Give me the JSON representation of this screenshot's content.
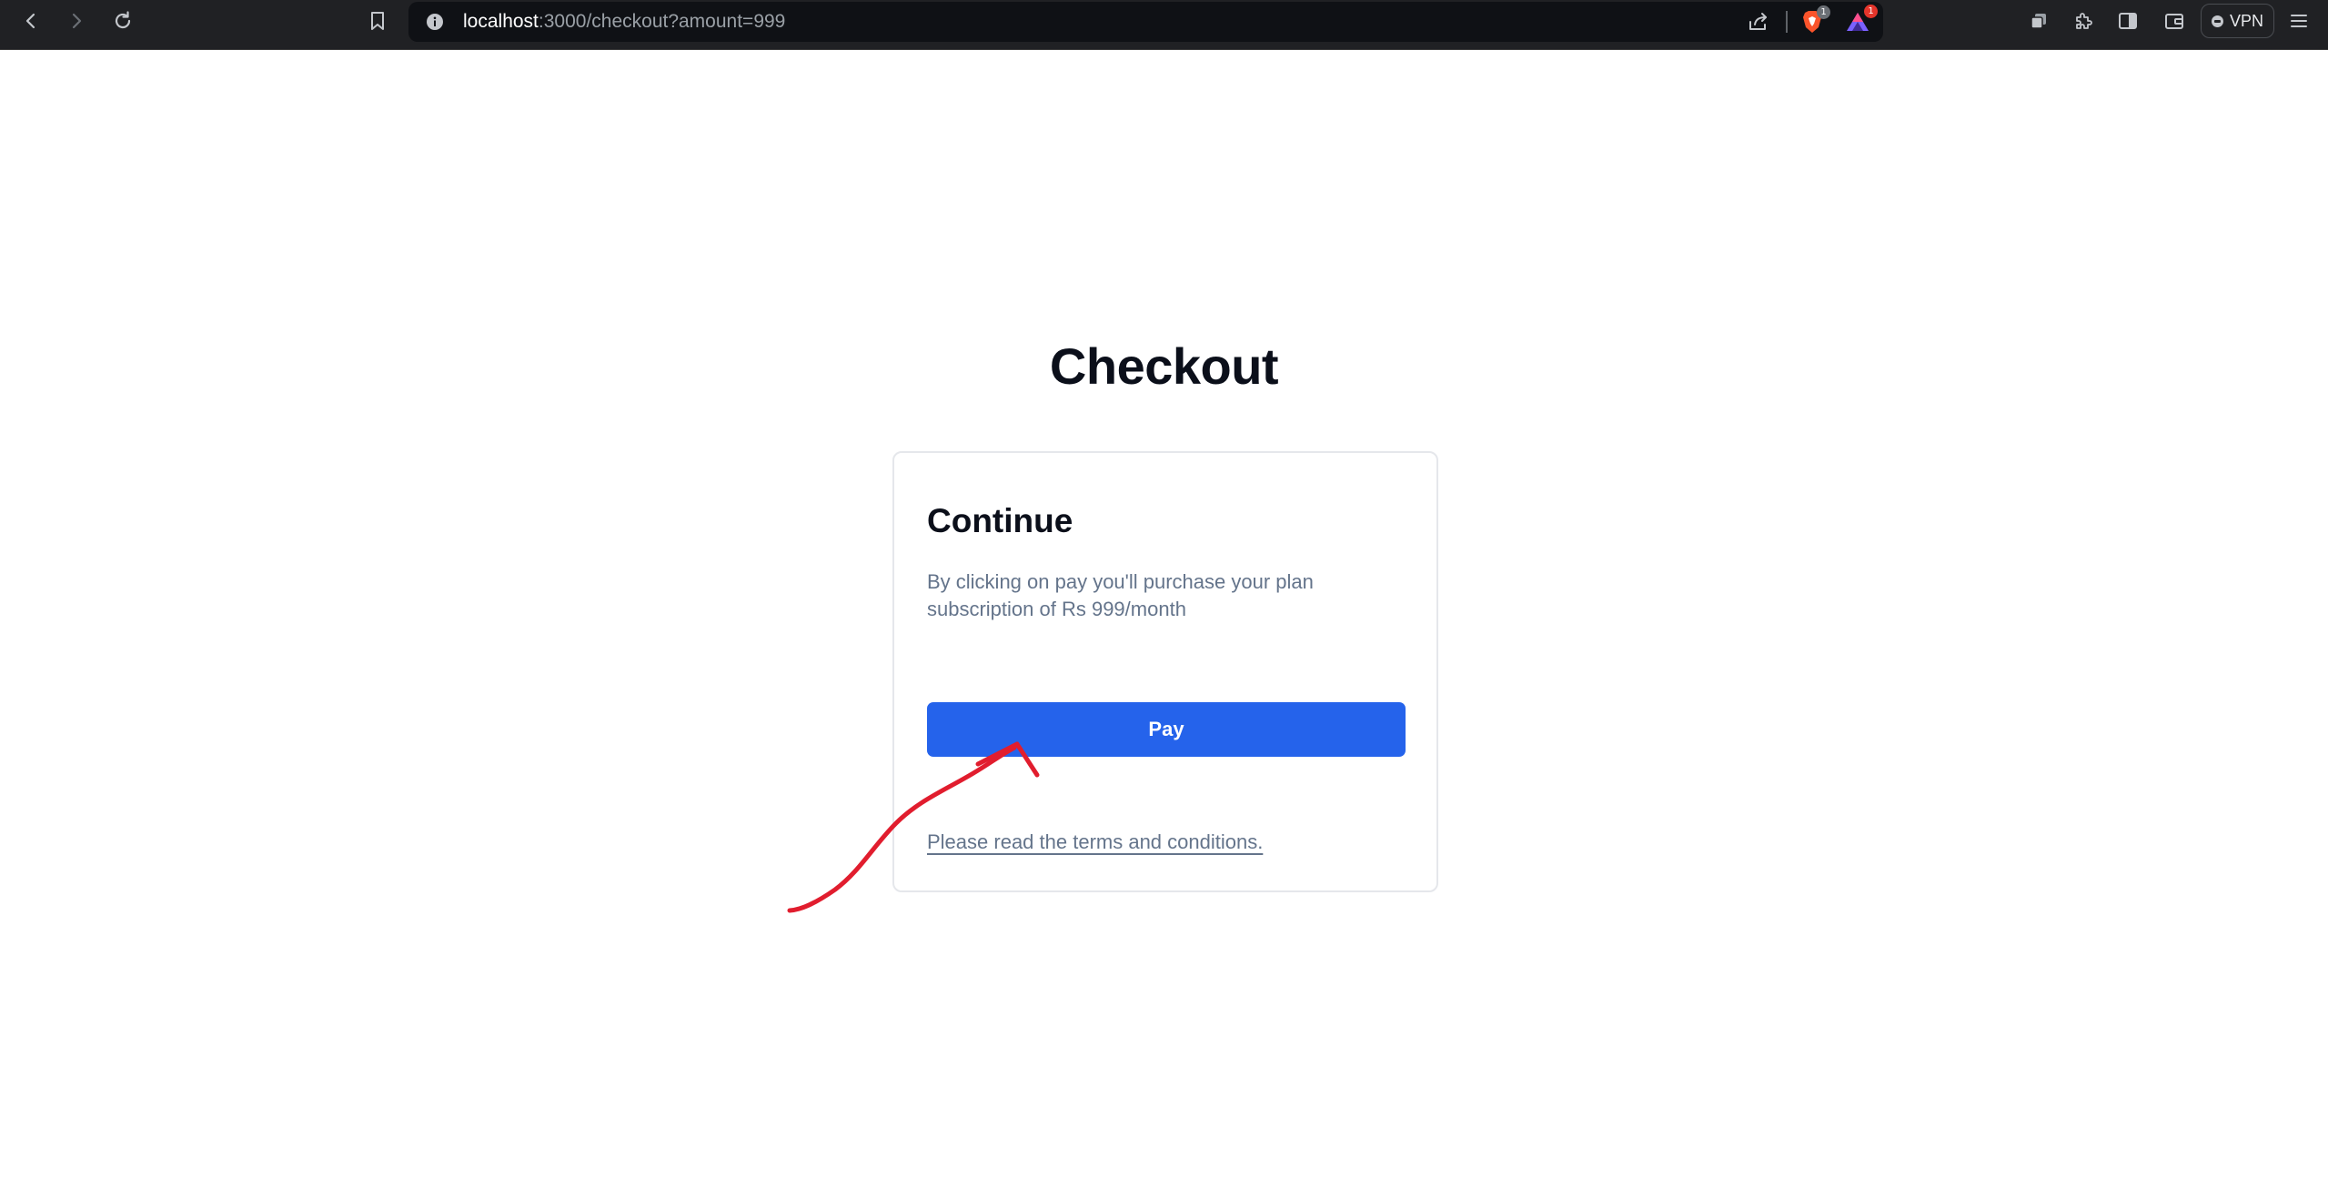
{
  "browser": {
    "url_host": "localhost",
    "url_path": ":3000/checkout?amount=999",
    "shield_badge_count": "1",
    "rewards_badge_count": "1",
    "vpn_label": "VPN",
    "icons": [
      "back-icon",
      "forward-icon",
      "reload-icon",
      "bookmark-icon",
      "info-icon",
      "share-icon",
      "brave-shield-icon",
      "brave-rewards-icon",
      "tabs-icon",
      "extensions-icon",
      "sidebar-icon",
      "wallet-icon",
      "menu-icon"
    ]
  },
  "page": {
    "title": "Checkout",
    "card": {
      "title": "Continue",
      "description": "By clicking on pay you'll purchase your plan subscription of Rs 999/month",
      "pay_button_label": "Pay",
      "terms_link": "Please read the terms and conditions."
    }
  },
  "colors": {
    "primary_button": "#2563eb",
    "annotation": "#e11d2e",
    "browser_chrome": "#202124"
  }
}
